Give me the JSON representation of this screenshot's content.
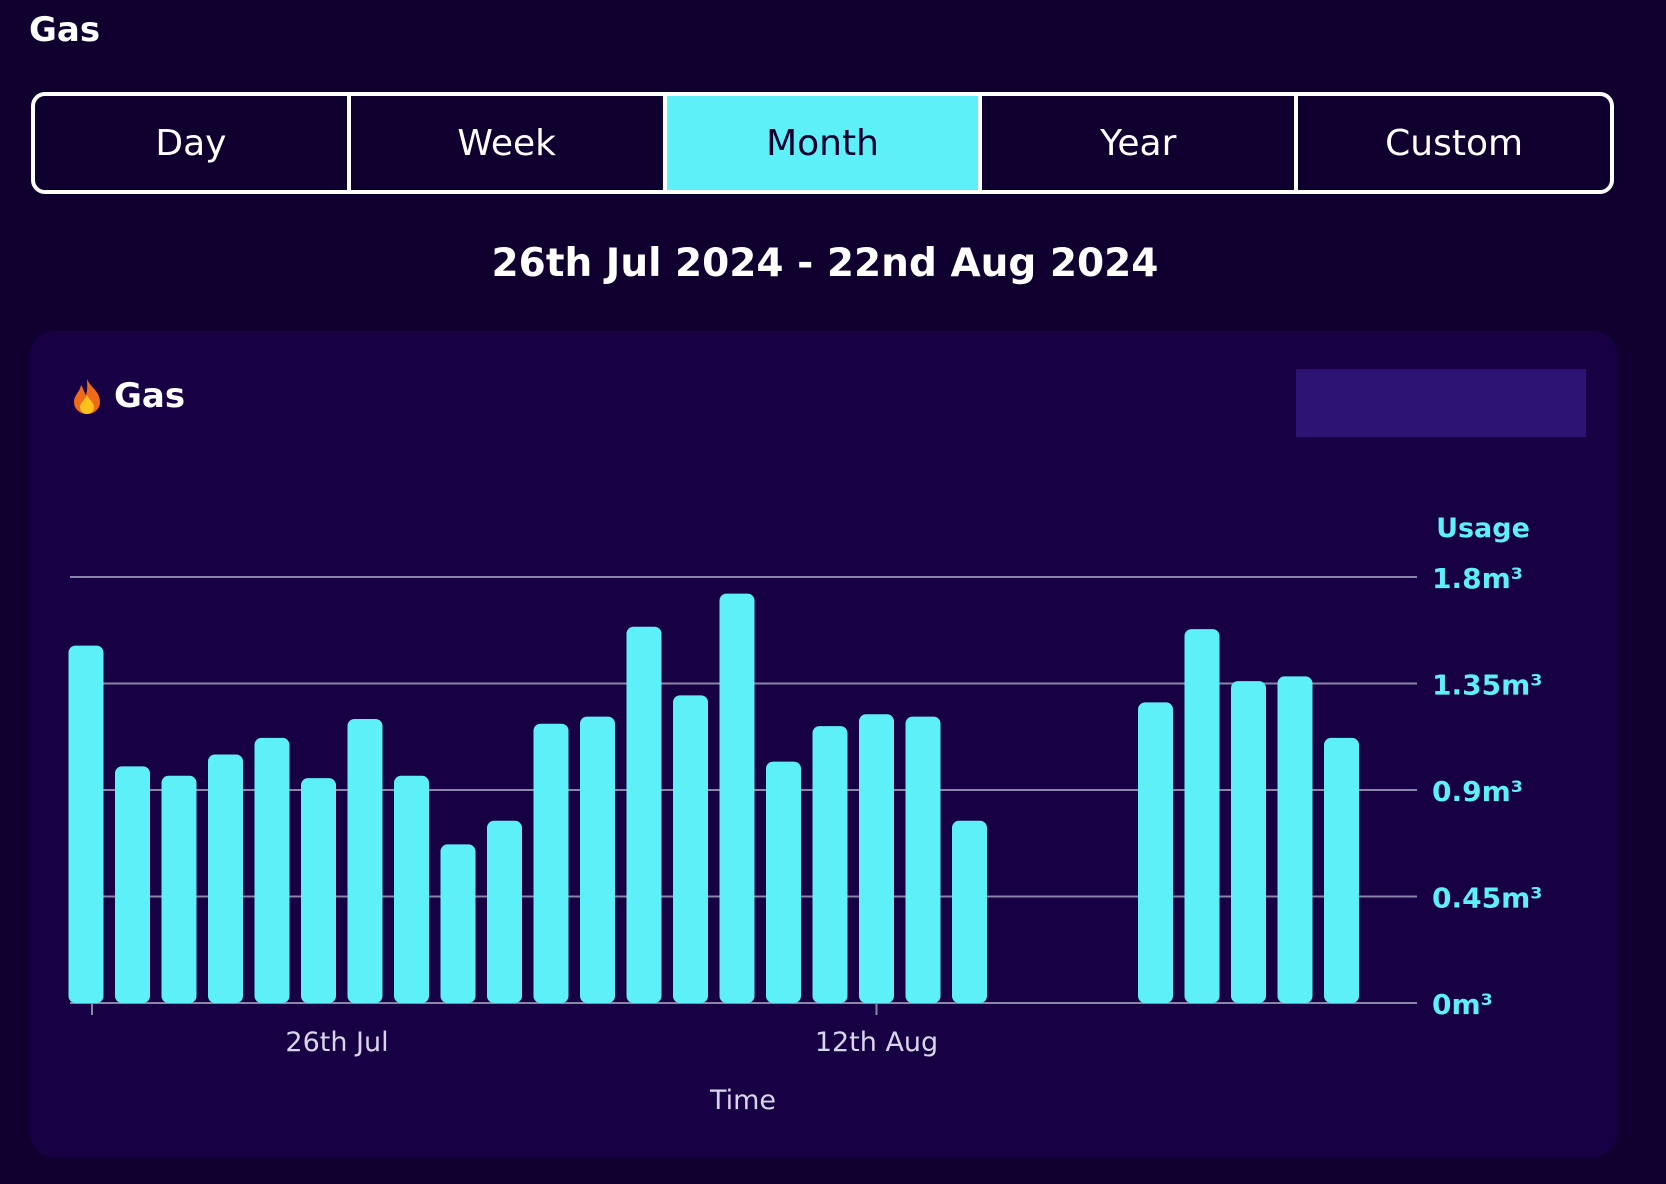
{
  "page": {
    "title": "Gas"
  },
  "tabs": [
    {
      "label": "Day",
      "active": false
    },
    {
      "label": "Week",
      "active": false
    },
    {
      "label": "Month",
      "active": true
    },
    {
      "label": "Year",
      "active": false
    },
    {
      "label": "Custom",
      "active": false
    }
  ],
  "date_range": "26th Jul 2024 - 22nd Aug 2024",
  "card": {
    "title": "Gas",
    "icon": "fire-icon"
  },
  "colors": {
    "accent": "#5ef0f8",
    "background": "#100030",
    "card": "#180045",
    "box": "#2c1475"
  },
  "chart_data": {
    "type": "bar",
    "title": "",
    "xlabel": "Time",
    "ylabel": "Usage",
    "ylim": [
      0,
      1.8
    ],
    "yticks": [
      "0m³",
      "0.45m³",
      "0.9m³",
      "1.35m³",
      "1.8m³"
    ],
    "x_tick_labels": [
      {
        "label": "26th Jul",
        "at_index": 0
      },
      {
        "label": "12th Aug",
        "at_index": 17
      }
    ],
    "grid": true,
    "values": [
      1.51,
      1.0,
      0.96,
      1.05,
      1.12,
      0.95,
      1.2,
      0.96,
      0.67,
      0.77,
      1.18,
      1.21,
      1.59,
      1.3,
      1.73,
      1.02,
      1.17,
      1.22,
      1.21,
      0.77,
      null,
      null,
      null,
      1.27,
      1.58,
      1.36,
      1.38,
      1.12
    ]
  }
}
